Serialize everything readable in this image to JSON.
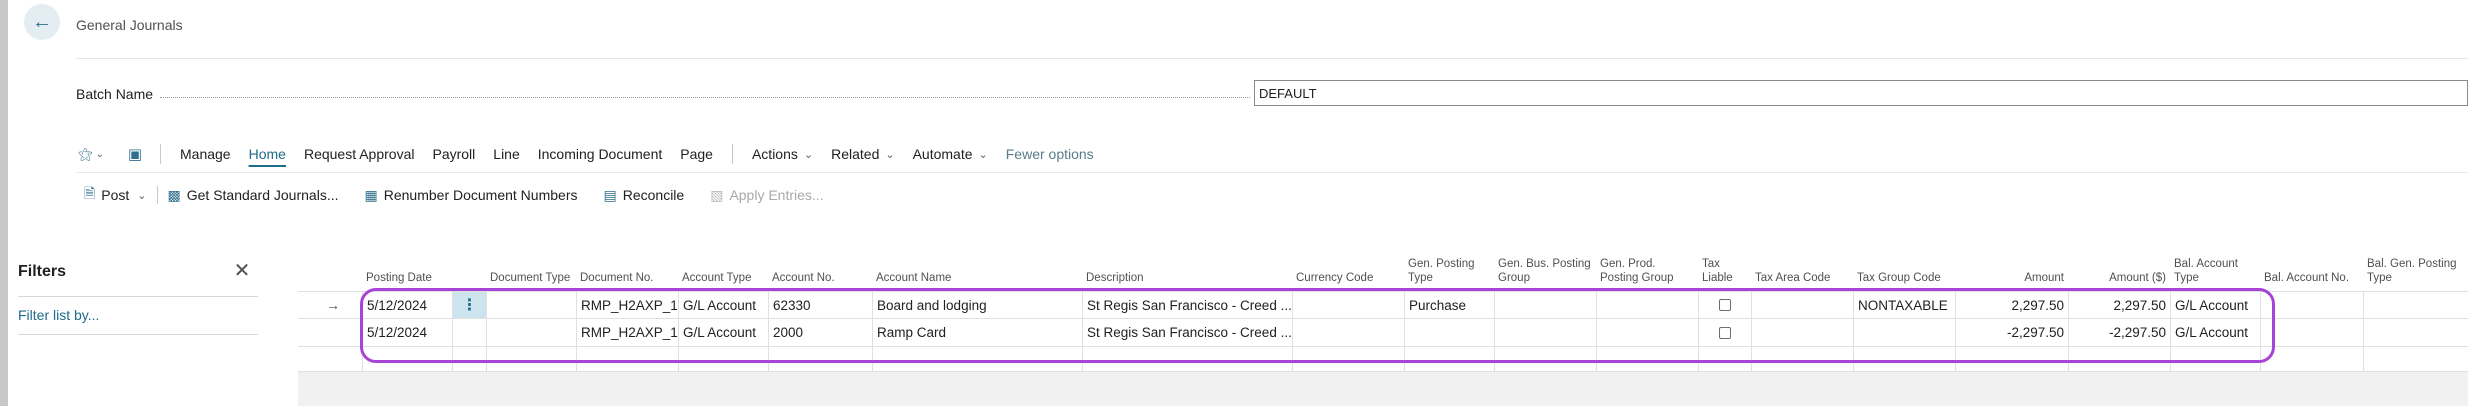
{
  "header": {
    "title": "General Journals"
  },
  "batch": {
    "label": "Batch Name",
    "value": "DEFAULT"
  },
  "commandbar": {
    "menu": [
      {
        "label": "Manage",
        "active": false,
        "chevron": false
      },
      {
        "label": "Home",
        "active": true,
        "chevron": false
      },
      {
        "label": "Request Approval",
        "active": false,
        "chevron": false
      },
      {
        "label": "Payroll",
        "active": false,
        "chevron": false
      },
      {
        "label": "Line",
        "active": false,
        "chevron": false
      },
      {
        "label": "Incoming Document",
        "active": false,
        "chevron": false
      },
      {
        "label": "Page",
        "active": false,
        "chevron": false
      }
    ],
    "menu2": [
      {
        "label": "Actions",
        "chevron": true
      },
      {
        "label": "Related",
        "chevron": true
      },
      {
        "label": "Automate",
        "chevron": true
      },
      {
        "label": "Fewer options",
        "chevron": false
      }
    ]
  },
  "actions": {
    "post": "Post",
    "get_std_journals": "Get Standard Journals...",
    "renumber": "Renumber Document Numbers",
    "reconcile": "Reconcile",
    "apply_entries": "Apply Entries..."
  },
  "filters": {
    "title": "Filters",
    "link": "Filter list by..."
  },
  "grid": {
    "columns": [
      {
        "key": "posting_date",
        "label": "Posting Date"
      },
      {
        "key": "document_type",
        "label": "Document Type"
      },
      {
        "key": "document_no",
        "label": "Document No."
      },
      {
        "key": "account_type",
        "label": "Account Type"
      },
      {
        "key": "account_no",
        "label": "Account No."
      },
      {
        "key": "account_name",
        "label": "Account Name"
      },
      {
        "key": "description",
        "label": "Description"
      },
      {
        "key": "currency_code",
        "label": "Currency Code"
      },
      {
        "key": "gen_posting_type",
        "label": "Gen. Posting Type"
      },
      {
        "key": "gen_bus_posting_group",
        "label": "Gen. Bus. Posting Group"
      },
      {
        "key": "gen_prod_posting_group",
        "label": "Gen. Prod. Posting Group"
      },
      {
        "key": "tax_liable",
        "label": "Tax Liable"
      },
      {
        "key": "tax_area_code",
        "label": "Tax Area Code"
      },
      {
        "key": "tax_group_code",
        "label": "Tax Group Code"
      },
      {
        "key": "amount",
        "label": "Amount"
      },
      {
        "key": "amount_usd",
        "label": "Amount ($)"
      },
      {
        "key": "bal_account_type",
        "label": "Bal. Account Type"
      },
      {
        "key": "bal_account_no",
        "label": "Bal. Account No."
      },
      {
        "key": "bal_gen_posting_type",
        "label": "Bal. Gen. Posting Type"
      }
    ],
    "rows": [
      {
        "posting_date": "5/12/2024",
        "document_type": "",
        "document_no": "RMP_H2AXP_1",
        "account_type": "G/L Account",
        "account_no": "62330",
        "account_name": "Board and lodging",
        "description": "St Regis San Francisco - Creed ...",
        "currency_code": "",
        "gen_posting_type": "Purchase",
        "gen_bus_posting_group": "",
        "gen_prod_posting_group": "",
        "tax_liable": false,
        "tax_area_code": "",
        "tax_group_code": "NONTAXABLE",
        "amount": "2,297.50",
        "amount_usd": "2,297.50",
        "bal_account_type": "G/L Account",
        "bal_account_no": "",
        "bal_gen_posting_type": ""
      },
      {
        "posting_date": "5/12/2024",
        "document_type": "",
        "document_no": "RMP_H2AXP_1",
        "account_type": "G/L Account",
        "account_no": "2000",
        "account_name": "Ramp Card",
        "description": "St Regis San Francisco - Creed ...",
        "currency_code": "",
        "gen_posting_type": "",
        "gen_bus_posting_group": "",
        "gen_prod_posting_group": "",
        "tax_liable": false,
        "tax_area_code": "",
        "tax_group_code": "",
        "amount": "-2,297.50",
        "amount_usd": "-2,297.50",
        "bal_account_type": "G/L Account",
        "bal_account_no": "",
        "bal_gen_posting_type": ""
      }
    ]
  },
  "colors": {
    "accent": "#1e6b8a",
    "highlight": "#a843d8",
    "selected_cell": "#cde4ef"
  }
}
